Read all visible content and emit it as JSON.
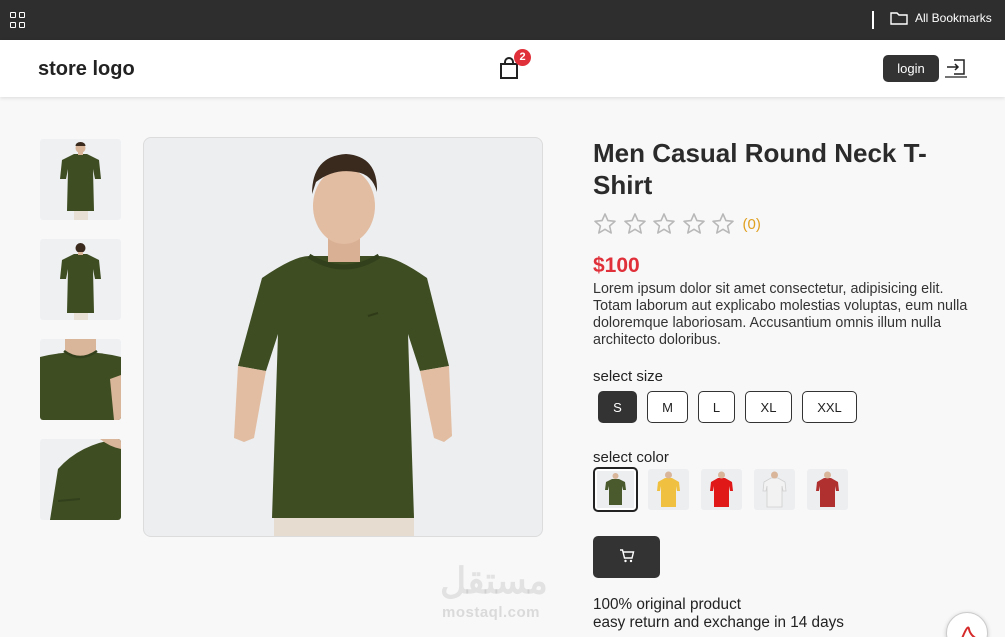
{
  "browser": {
    "bookmarks_label": "All Bookmarks"
  },
  "header": {
    "logo": "store logo",
    "cart_count": "2",
    "login_label": "login"
  },
  "product": {
    "title": "Men Casual Round Neck T-Shirt",
    "rating": 0,
    "rating_count": "(0)",
    "price": "$100",
    "description": "Lorem ipsum dolor sit amet consectetur, adipisicing elit. Totam laborum aut explicabo molestias voluptas, eum nulla doloremque laboriosam. Accusantium omnis illum nulla architecto doloribus.",
    "size_label": "select size",
    "sizes": [
      "S",
      "M",
      "L",
      "XL",
      "XXL"
    ],
    "selected_size": "S",
    "color_label": "select color",
    "colors": [
      "#4a5a2c",
      "#f0c040",
      "#e01818",
      "#f2f2f2",
      "#b03030"
    ],
    "selected_color": "#4a5a2c",
    "notes": [
      "100% original product",
      "easy return and exchange in 14 days"
    ]
  },
  "watermark": {
    "arabic": "مستقل",
    "latin": "mostaql.com"
  },
  "colors": {
    "accent": "#e0303a",
    "dark": "#333333",
    "rating": "#e0a020"
  }
}
